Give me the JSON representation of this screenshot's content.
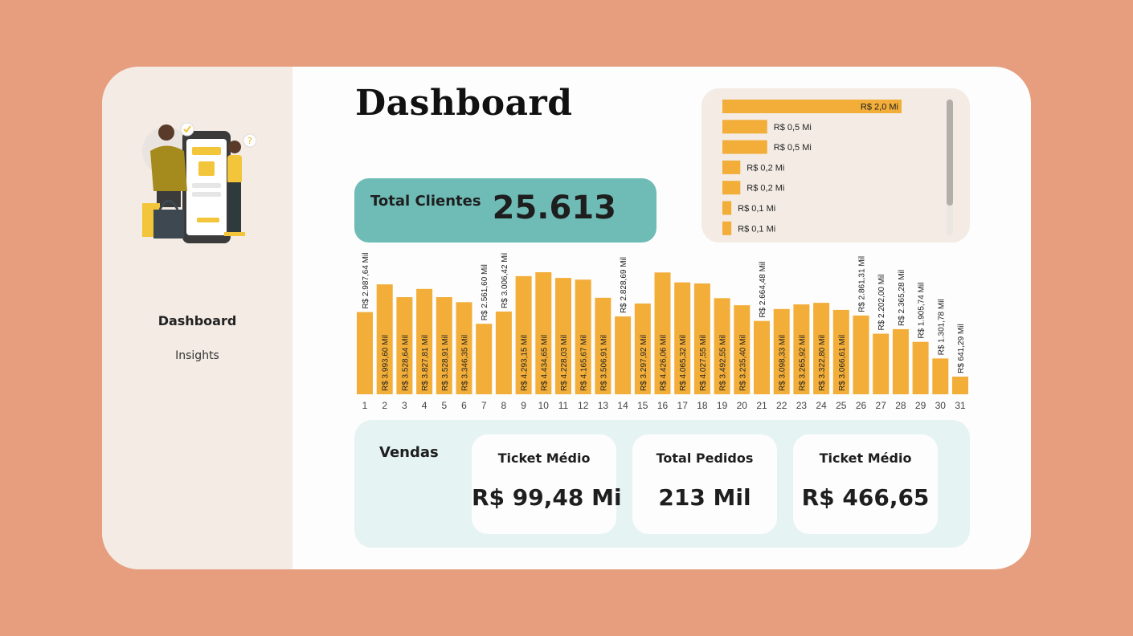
{
  "sidebar": {
    "nav_title": "Dashboard",
    "nav_sub": "Insights"
  },
  "header": {
    "title": "Dashboard"
  },
  "total_clientes": {
    "label": "Total Clientes",
    "value": "25.613"
  },
  "colors": {
    "background": "#e69e7e",
    "accent_bar": "#f2ae39",
    "kpi_teal": "#6fbcb7",
    "sidebar": "#f3ebe4",
    "vendas_panel": "#e6f3f3"
  },
  "chart_data": [
    {
      "type": "bar",
      "orientation": "horizontal",
      "labels": [
        "R$ 2,0 Mi",
        "R$ 0,5 Mi",
        "R$ 0,5 Mi",
        "R$ 0,2 Mi",
        "R$ 0,2 Mi",
        "R$ 0,1 Mi",
        "R$ 0,1 Mi"
      ],
      "values": [
        2.0,
        0.5,
        0.5,
        0.2,
        0.2,
        0.1,
        0.1
      ],
      "title": "",
      "scrollable": true
    },
    {
      "type": "bar",
      "categories": [
        "1",
        "2",
        "3",
        "4",
        "5",
        "6",
        "7",
        "8",
        "9",
        "10",
        "11",
        "12",
        "13",
        "14",
        "15",
        "16",
        "17",
        "18",
        "19",
        "20",
        "21",
        "22",
        "23",
        "24",
        "25",
        "26",
        "27",
        "28",
        "29",
        "30",
        "31"
      ],
      "values": [
        2987.64,
        3993.6,
        3528.64,
        3827.81,
        3528.91,
        3346.35,
        2561.6,
        3006.42,
        4293.15,
        4434.65,
        4228.03,
        4165.67,
        3506.91,
        2828.69,
        3297.92,
        4426.06,
        4065.32,
        4027.55,
        3492.55,
        3235.4,
        2664.48,
        3098.33,
        3265.92,
        3322.8,
        3066.61,
        2861.31,
        2202.0,
        2365.28,
        1905.74,
        1301.78,
        641.29
      ],
      "labels": [
        "R$ 2.987,64 Mil",
        "R$ 3.993,60 Mil",
        "R$ 3.528,64 Mil",
        "R$ 3.827,81 Mil",
        "R$ 3.528,91 Mil",
        "R$ 3.346,35 Mil",
        "R$ 2.561,60 Mil",
        "R$ 3.006,42 Mil",
        "R$ 4.293,15 Mil",
        "R$ 4.434,65 Mil",
        "R$ 4.228,03 Mil",
        "R$ 4.165,67 Mil",
        "R$ 3.506,91 Mil",
        "R$ 2.828,69 Mil",
        "R$ 3.297,92 Mil",
        "R$ 4.426,06 Mil",
        "R$ 4.065,32 Mil",
        "R$ 4.027,55 Mil",
        "R$ 3.492,55 Mil",
        "R$ 3.235,40 Mil",
        "R$ 2.664,48 Mil",
        "R$ 3.098,33 Mil",
        "R$ 3.265,92 Mil",
        "R$ 3.322,80 Mil",
        "R$ 3.066,61 Mil",
        "R$ 2.861,31 Mil",
        "R$ 2.202,00 Mil",
        "R$ 2.365,28 Mil",
        "R$ 1.905,74 Mil",
        "R$ 1.301,78 Mil",
        "R$ 641,29 Mil"
      ],
      "title": "",
      "xlabel": "",
      "ylabel": "",
      "grid": false
    }
  ],
  "vendas": {
    "label": "Vendas",
    "metrics": [
      {
        "label": "Ticket Médio",
        "value": "R$ 99,48 Mi"
      },
      {
        "label": "Total Pedidos",
        "value": "213 Mil"
      },
      {
        "label": "Ticket Médio",
        "value": "R$ 466,65"
      }
    ]
  }
}
